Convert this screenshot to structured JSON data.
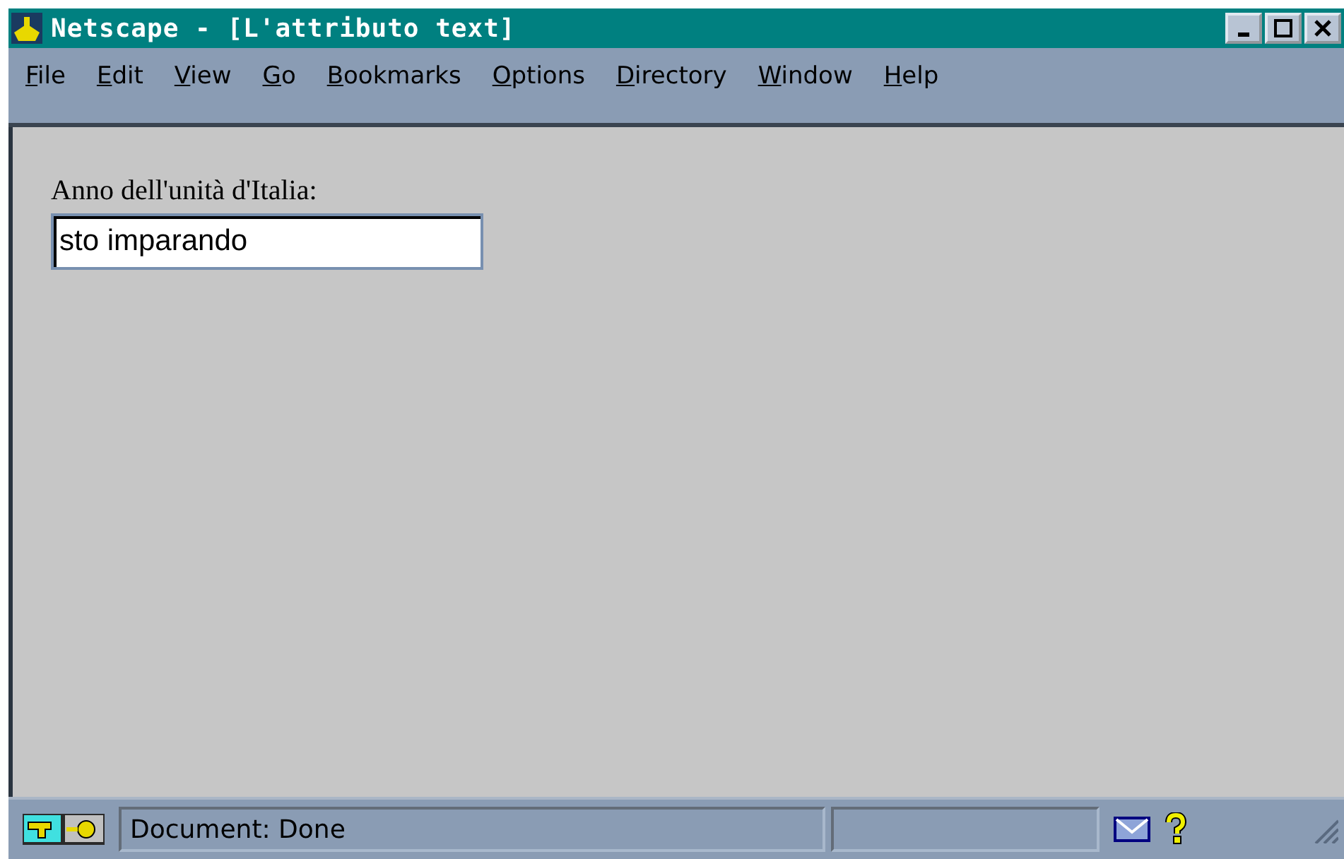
{
  "window": {
    "title": "Netscape - [L'attributo text]"
  },
  "menu": [
    "File",
    "Edit",
    "View",
    "Go",
    "Bookmarks",
    "Options",
    "Directory",
    "Window",
    "Help"
  ],
  "form": {
    "label": "Anno dell'unità d'Italia:",
    "value": "sto imparando"
  },
  "status_bar": {
    "message": "Document: Done"
  }
}
